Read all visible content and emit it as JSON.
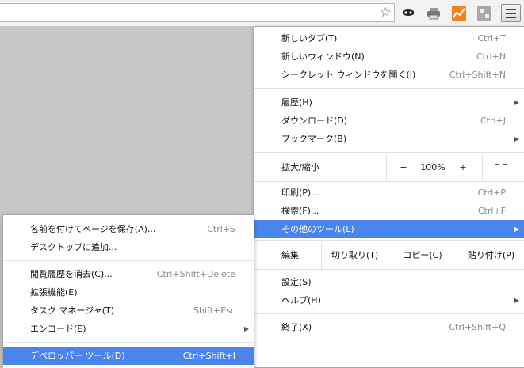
{
  "toolbar": {
    "star_glyph": "☆",
    "extensions": [
      "incognito-mask-icon",
      "printer-icon",
      "analytics-chart-icon",
      "puzzle-settings-icon"
    ],
    "menu_button": "chrome-menu-icon"
  },
  "main_menu": {
    "new_tab": {
      "label": "新しいタブ(T)",
      "accel": "Ctrl+T"
    },
    "new_window": {
      "label": "新しいウィンドウ(N)",
      "accel": "Ctrl+N"
    },
    "incognito": {
      "label": "シークレット ウィンドウを開く(I)",
      "accel": "Ctrl+Shift+N"
    },
    "history": {
      "label": "履歴(H)"
    },
    "downloads": {
      "label": "ダウンロード(D)",
      "accel": "Ctrl+J"
    },
    "bookmarks": {
      "label": "ブックマーク(B)"
    },
    "zoom": {
      "label": "拡大/縮小",
      "minus": "−",
      "value": "100%",
      "plus": "+"
    },
    "print": {
      "label": "印刷(P)...",
      "accel": "Ctrl+P"
    },
    "find": {
      "label": "検索(F)...",
      "accel": "Ctrl+F"
    },
    "more_tools": {
      "label": "その他のツール(L)"
    },
    "edit": {
      "label": "編集",
      "cut": "切り取り(T)",
      "copy": "コピー(C)",
      "paste": "貼り付け(P)"
    },
    "settings": {
      "label": "設定(S)"
    },
    "help": {
      "label": "ヘルプ(H)"
    },
    "exit": {
      "label": "終了(X)",
      "accel": "Ctrl+Shift+Q"
    }
  },
  "sub_menu": {
    "save_as": {
      "label": "名前を付けてページを保存(A)...",
      "accel": "Ctrl+S"
    },
    "add_desktop": {
      "label": "デスクトップに追加..."
    },
    "clear_data": {
      "label": "閲覧履歴を消去(C)...",
      "accel": "Ctrl+Shift+Delete"
    },
    "extensions": {
      "label": "拡張機能(E)"
    },
    "task_manager": {
      "label": "タスク マネージャ(T)",
      "accel": "Shift+Esc"
    },
    "encoding": {
      "label": "エンコード(E)"
    },
    "dev_tools": {
      "label": "デベロッパー ツール(D)",
      "accel": "Ctrl+Shift+I"
    }
  },
  "colors": {
    "highlight": "#4985ea",
    "background": "#c7c7c7",
    "accel_text": "#8a8a8a"
  }
}
